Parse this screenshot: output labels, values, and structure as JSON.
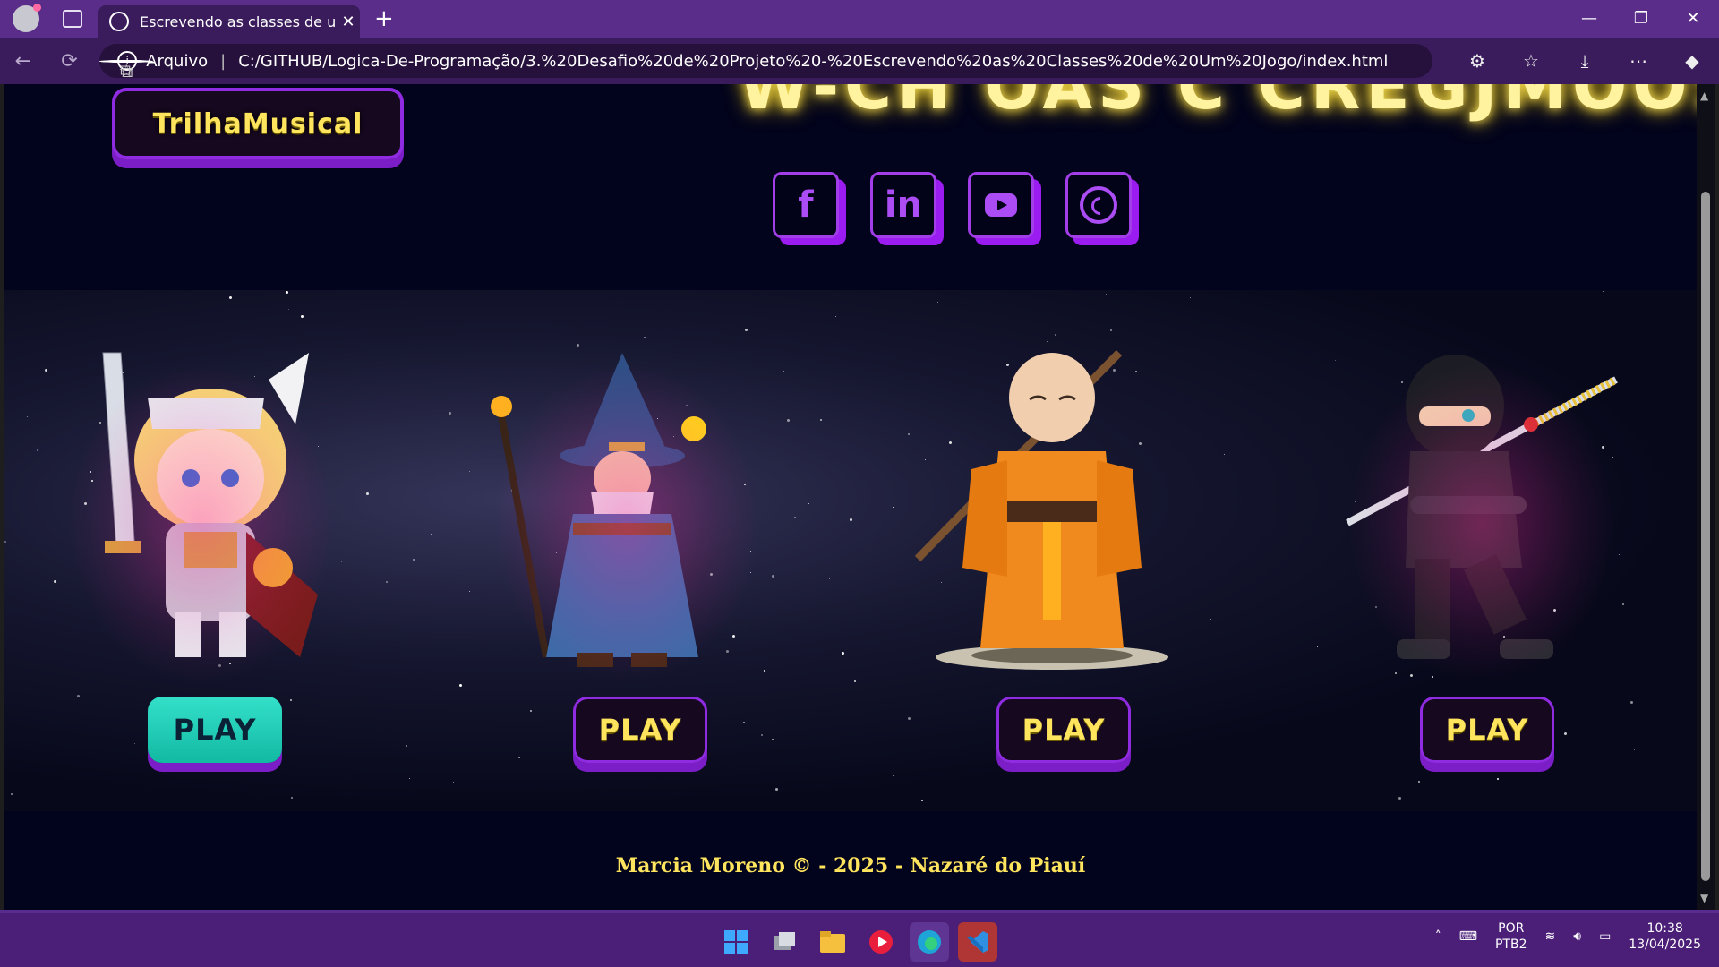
{
  "browser": {
    "tab_title": "Escrevendo as classes de um Jogo",
    "tab_close": "✕",
    "new_tab": "+",
    "window_controls": [
      "—",
      "❐",
      "✕"
    ],
    "nav": {
      "back": "←",
      "reload": "⟳"
    },
    "address": {
      "scheme_label": "Arquivo",
      "url": "C:/GITHUB/Logica-De-Programação/3.%20Desafio%20de%20Projeto%20-%20Escrevendo%20as%20Classes%20de%20Um%20Jogo/index.html"
    }
  },
  "page": {
    "heading_partial": "W-CH OAS C CREGJMOOS",
    "music_button": "TrilhaMusical",
    "socials": [
      "facebook-icon",
      "linkedin-icon",
      "youtube-icon",
      "whatsapp-icon"
    ],
    "social_glyphs": {
      "facebook": "f",
      "linkedin": "in"
    },
    "characters": [
      {
        "name": "warrior",
        "play_label": "PLAY",
        "style": "teal"
      },
      {
        "name": "wizard",
        "play_label": "PLAY",
        "style": "dark"
      },
      {
        "name": "monk",
        "play_label": "PLAY",
        "style": "dark"
      },
      {
        "name": "ninja",
        "play_label": "PLAY",
        "style": "dark"
      }
    ],
    "footer": "Marcia Moreno © - 2025 - Nazaré do Piauí"
  },
  "taskbar": {
    "language": "POR",
    "layout": "PTB2",
    "time": "10:38",
    "date": "13/04/2025"
  },
  "colors": {
    "accent": "#9a1cf0",
    "gold": "#ffe45e",
    "teal": "#2fd5bf",
    "page_bg": "#02031c"
  }
}
